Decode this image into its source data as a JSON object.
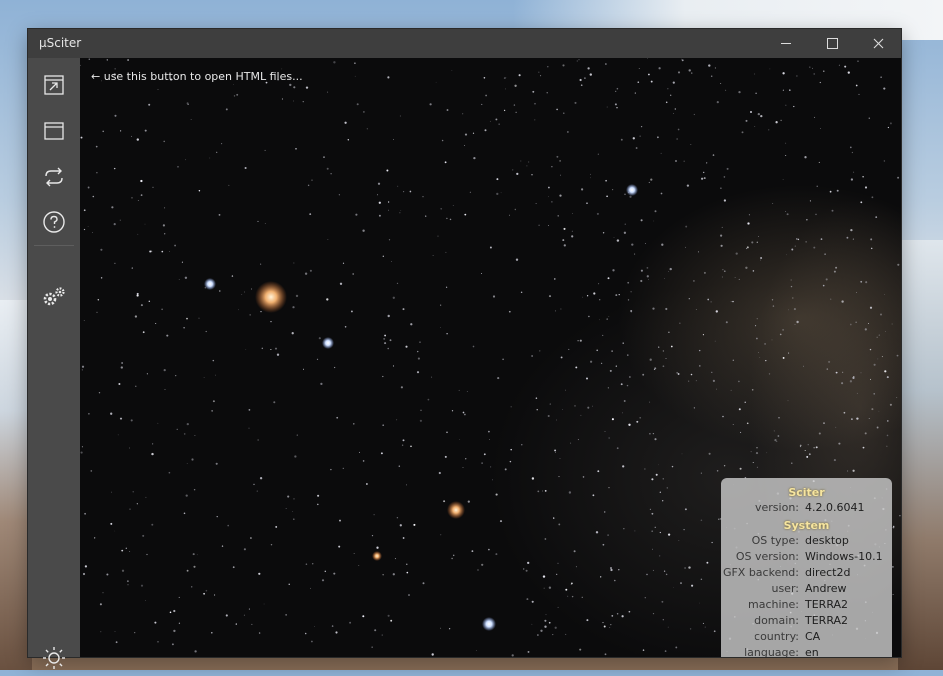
{
  "window": {
    "title": "µSciter"
  },
  "sidebar": {
    "items": [
      {
        "icon": "open-file-icon",
        "label": ""
      },
      {
        "icon": "window-icon",
        "label": ""
      },
      {
        "icon": "reload-icon",
        "label": ""
      },
      {
        "icon": "help-icon",
        "label": ""
      },
      {
        "icon": "settings-gears-icon",
        "label": ""
      },
      {
        "icon": "theme-sun-icon",
        "label": ""
      }
    ]
  },
  "content": {
    "hint_text": "use this button to open HTML files..."
  },
  "info": {
    "sciter_heading": "Sciter",
    "sciter_rows": [
      {
        "key": "version:",
        "value": "4.2.0.6041"
      }
    ],
    "system_heading": "System",
    "system_rows": [
      {
        "key": "OS type:",
        "value": "desktop"
      },
      {
        "key": "OS version:",
        "value": "Windows-10.1"
      },
      {
        "key": "GFX backend:",
        "value": "direct2d"
      },
      {
        "key": "user:",
        "value": "Andrew"
      },
      {
        "key": "machine:",
        "value": "TERRA2"
      },
      {
        "key": "domain:",
        "value": "TERRA2"
      },
      {
        "key": "country:",
        "value": "CA"
      },
      {
        "key": "language:",
        "value": "en"
      }
    ]
  },
  "colors": {
    "titlebar": "#3e3e3e",
    "sidebar": "#4a4a4a",
    "panel_heading": "#f6e5a0"
  }
}
